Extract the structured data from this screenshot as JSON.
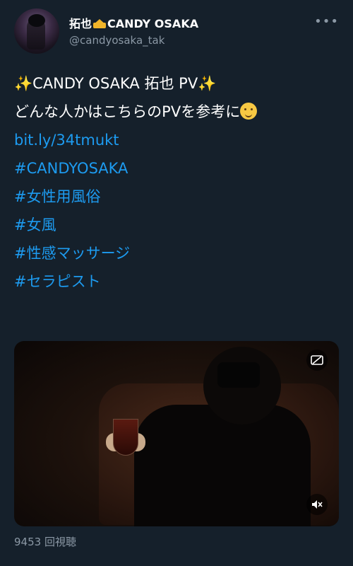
{
  "author": {
    "name_part1": "拓也",
    "name_part2": "CANDY OSAKA",
    "crown_icon": "crown-emoji",
    "handle": "@candyosaka_tak"
  },
  "menu": {
    "more_icon": "ellipsis-icon",
    "more_label": "•••"
  },
  "tweet": {
    "line1_prefix": "✨",
    "line1_text": "CANDY OSAKA 拓也 PV",
    "line1_suffix": "✨",
    "line2_text": "どんな人かはこちらのPVを参考に",
    "link": "bit.ly/34tmukt",
    "hashtags": [
      "#CANDYOSAKA",
      "#女性用風俗",
      "#女風",
      "#性感マッサージ",
      "#セラピスト"
    ]
  },
  "video": {
    "top_icon": "gif-icon",
    "bottom_icon": "muted-speaker-icon"
  },
  "views_text": "9453 回視聴",
  "colors": {
    "background": "#15202b",
    "link": "#1d9bf0",
    "secondary_text": "#8b98a5"
  }
}
